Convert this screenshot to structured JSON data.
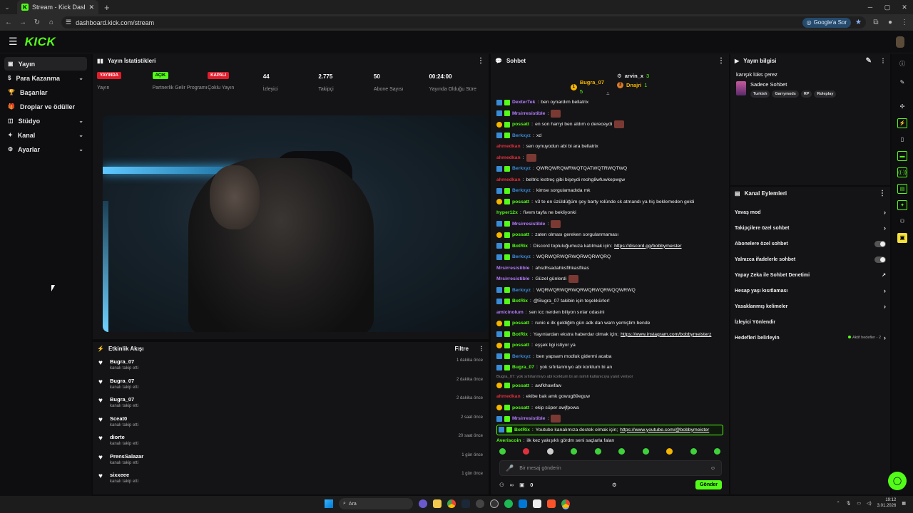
{
  "browser": {
    "tab_title": "Stream - Kick Dashboard",
    "url": "dashboard.kick.com/stream",
    "google_sor": "Google'a Sor"
  },
  "header": {
    "logo": "KICK"
  },
  "sidebar": {
    "items": [
      {
        "label": "Yayın",
        "active": true,
        "chevron": false
      },
      {
        "label": "Para Kazanma",
        "active": false,
        "chevron": true
      },
      {
        "label": "Başarılar",
        "active": false,
        "chevron": false
      },
      {
        "label": "Droplar ve ödüller",
        "active": false,
        "chevron": false
      },
      {
        "label": "Stüdyo",
        "active": false,
        "chevron": true
      },
      {
        "label": "Kanal",
        "active": false,
        "chevron": true
      },
      {
        "label": "Ayarlar",
        "active": false,
        "chevron": true
      }
    ]
  },
  "stats": {
    "title": "Yayın İstatistikleri",
    "items": [
      {
        "badge": "YAYINDA",
        "badge_color": "red",
        "label": "Yayın"
      },
      {
        "badge": "AÇIK",
        "badge_color": "green",
        "label": "Partnerlik Gelir Programı"
      },
      {
        "badge": "KAPALI",
        "badge_color": "red",
        "label": "Çoklu Yayın"
      },
      {
        "value": "44",
        "label": "İzleyici"
      },
      {
        "value": "2.775",
        "label": "Takipçi"
      },
      {
        "value": "50",
        "label": "Abone Sayısı"
      },
      {
        "value": "00:24:00",
        "label": "Yayında Olduğu Süre"
      }
    ]
  },
  "events": {
    "title": "Etkinlik Akışı",
    "filter": "Filtre",
    "items": [
      {
        "name": "Bugra_07",
        "sub": "kanalı takip etti",
        "time": "1 dakika önce"
      },
      {
        "name": "Bugra_07",
        "sub": "kanalı takip etti",
        "time": "2 dakika önce"
      },
      {
        "name": "Bugra_07",
        "sub": "kanalı takip etti",
        "time": "2 dakika önce"
      },
      {
        "name": "Sceat0",
        "sub": "kanalı takip etti",
        "time": "2 saat önce"
      },
      {
        "name": "diorte",
        "sub": "kanalı takip etti",
        "time": "20 saat önce"
      },
      {
        "name": "PrensSalazar",
        "sub": "kanalı takip etti",
        "time": "1 gün önce"
      },
      {
        "name": "sixxeee",
        "sub": "kanalı takip etti",
        "time": "1 gün önce"
      }
    ]
  },
  "chat": {
    "title": "Sohbet",
    "top": {
      "user1": "Bugra_07",
      "user1_count": "5",
      "user2": "arvin_x",
      "user2_count": "3",
      "user3": "Dnajri",
      "user3_count": "1"
    },
    "messages": [
      {
        "icons": [
          "blue",
          "green"
        ],
        "user": "DexterTek",
        "color": "#b57cff",
        "text": "ben oynardım bellatrix",
        "emote": false
      },
      {
        "icons": [
          "blue",
          "green"
        ],
        "user": "Mrsirresistible",
        "color": "#b57cff",
        "text": "",
        "emote": true
      },
      {
        "icons": [
          "gold",
          "green"
        ],
        "user": "possatt",
        "color": "#53fc18",
        "text": "en son harryi ben aldım o dereceydi",
        "emote": true
      },
      {
        "icons": [
          "blue",
          "green"
        ],
        "user": "Berkxyz",
        "color": "#3a8bd6",
        "text": "xd",
        "emote": false
      },
      {
        "icons": [],
        "user": "ahmedkan",
        "color": "#e0303c",
        "text": "sen oynuyodun abi bi ara bellatrix",
        "emote": false
      },
      {
        "icons": [],
        "user": "ahmedkan",
        "color": "#e0303c",
        "text": "",
        "emote": true
      },
      {
        "icons": [
          "blue",
          "green"
        ],
        "user": "Berkxyz",
        "color": "#3a8bd6",
        "text": "QWRQWRQWRWQTQATWQTRWQTWQ",
        "emote": false
      },
      {
        "icons": [],
        "user": "ahmedkan",
        "color": "#e0303c",
        "text": "beltric lestreç gibi bişeydi reohg8wfuwkepwgw",
        "emote": false
      },
      {
        "icons": [
          "blue",
          "green"
        ],
        "user": "Berkxyz",
        "color": "#3a8bd6",
        "text": "kimse sorgulamadıda mk",
        "emote": false
      },
      {
        "icons": [
          "gold",
          "green"
        ],
        "user": "possatt",
        "color": "#53fc18",
        "text": "v3 te en üzüldüğüm şey barty rolünde ck atmandı ya hiç beklemeden geldi",
        "emote": false
      },
      {
        "icons": [],
        "user": "hyper12x",
        "color": "#53fc18",
        "text": "fivem tayfa ne bekliyonki",
        "emote": false
      },
      {
        "icons": [
          "blue",
          "green"
        ],
        "user": "Mrsirresistible",
        "color": "#b57cff",
        "text": "",
        "emote": true
      },
      {
        "icons": [
          "gold",
          "green"
        ],
        "user": "possatt",
        "color": "#53fc18",
        "text": "zaten olması gereken sorgulanmaması",
        "emote": false
      },
      {
        "icons": [
          "blue",
          "green"
        ],
        "user": "BotRix",
        "color": "#53fc18",
        "text": "Discord topluluğumuza katılmak için: ",
        "link": "https://discord.gg/bobbymeister",
        "emote": false
      },
      {
        "icons": [
          "blue",
          "green"
        ],
        "user": "Berkxyz",
        "color": "#3a8bd6",
        "text": "WQRWQRWQRWQRWQRWQRQ",
        "emote": false
      },
      {
        "icons": [],
        "user": "Mrsirresistible",
        "color": "#b57cff",
        "text": "ahsdhsadahksflhkasflkas",
        "emote": false
      },
      {
        "icons": [],
        "user": "Mrsirresistible",
        "color": "#b57cff",
        "text": "Güzel günlerdi",
        "emote": true
      },
      {
        "icons": [
          "blue",
          "green"
        ],
        "user": "Berkxyz",
        "color": "#3a8bd6",
        "text": "WQRWQRWQRWQRWQRWQRWQQWRWQ",
        "emote": false
      },
      {
        "icons": [
          "blue",
          "green"
        ],
        "user": "BotRix",
        "color": "#53fc18",
        "text": "@Bugra_07 takibin için teşekkürler!",
        "emote": false
      },
      {
        "icons": [],
        "user": "amicinolum",
        "color": "#b57cff",
        "text": "sen icc nerden biliyon sırlar odasini",
        "emote": false
      },
      {
        "icons": [
          "gold",
          "green"
        ],
        "user": "possatt",
        "color": "#53fc18",
        "text": "runic e ilk geldiğim gün adk dan warn yemiştim bende",
        "emote": false
      },
      {
        "icons": [
          "blue",
          "green"
        ],
        "user": "BotRix",
        "color": "#53fc18",
        "text": "Yayınlardan ekstra haberdar olmak için; ",
        "link": "https://www.instagram.com/bobbymeisterz",
        "emote": false
      },
      {
        "icons": [
          "gold",
          "green"
        ],
        "user": "possatt",
        "color": "#53fc18",
        "text": "eşşek ligi istiyor ya",
        "emote": false
      },
      {
        "icons": [
          "blue",
          "green"
        ],
        "user": "Berkxyz",
        "color": "#3a8bd6",
        "text": "ben yapsam modluk gidermi acaba",
        "emote": false
      },
      {
        "icons": [
          "blue",
          "green"
        ],
        "user": "Bugra_07",
        "color": "#53fc18",
        "text": "yok sıfırlanmıyo abi korktum bi an",
        "emote": false
      },
      {
        "reply": "Bugra_07: yok sıfırlanmıyo abi korktum bi an isimli kullanıcıya yanıt veriyor"
      },
      {
        "icons": [
          "gold",
          "green"
        ],
        "user": "possatt",
        "color": "#53fc18",
        "text": "awfkhawfaw",
        "emote": false
      },
      {
        "icons": [],
        "user": "ahmedkan",
        "color": "#e0303c",
        "text": "ekibe bak amk gowug89eguw",
        "emote": false
      },
      {
        "icons": [
          "gold",
          "green"
        ],
        "user": "possatt",
        "color": "#53fc18",
        "text": "ekip süper awjfpowa",
        "emote": false
      },
      {
        "icons": [
          "blue",
          "green"
        ],
        "user": "Mrsirresistible",
        "color": "#b57cff",
        "text": "",
        "emote": true
      },
      {
        "icons": [
          "blue",
          "green"
        ],
        "user": "BotRix",
        "color": "#53fc18",
        "text": "Youtube kanalımıza destek olmak için; ",
        "link": "https://www.youtube.com/@bobbymeister",
        "emote": false,
        "highlight": true
      },
      {
        "icons": [],
        "user": "Averiscoin",
        "color": "#53fc18",
        "text": "ilk kez yakışıklı gördm seni saçlarla falan",
        "emote": false
      }
    ],
    "input_placeholder": "Bir mesaj gönderin",
    "infinity": "∞",
    "count": "0",
    "send_label": "Gönder"
  },
  "info": {
    "title": "Yayın bilgisi",
    "stream_title": "karışık lüks çerez",
    "category": "Sadece Sohbet",
    "tags": [
      "Turkish",
      "Garrymods",
      "RP",
      "Roleplay"
    ]
  },
  "actions": {
    "title": "Kanal Eylemleri",
    "items": [
      {
        "label": "Yavaş mod",
        "control": "arrow"
      },
      {
        "label": "Takipçilere özel sohbet",
        "control": "arrow"
      },
      {
        "label": "Abonelere özel sohbet",
        "control": "toggle"
      },
      {
        "label": "Yalnızca ifadelerle sohbet",
        "control": "toggle"
      },
      {
        "label": "Yapay Zeka ile Sohbet Denetimi",
        "control": "ext"
      },
      {
        "label": "Hesap yaşı kısıtlaması",
        "control": "arrow"
      },
      {
        "label": "Yasaklanmış kelimeler",
        "control": "arrow"
      },
      {
        "label": "İzleyici Yönlendir",
        "control": "none"
      },
      {
        "label": "Hedefleri belirleyin",
        "control": "arrow",
        "extra": "Aktif hedefler - 2"
      }
    ]
  },
  "taskbar": {
    "search": "Ara",
    "time": "19:12",
    "date": "3.01.2026"
  }
}
